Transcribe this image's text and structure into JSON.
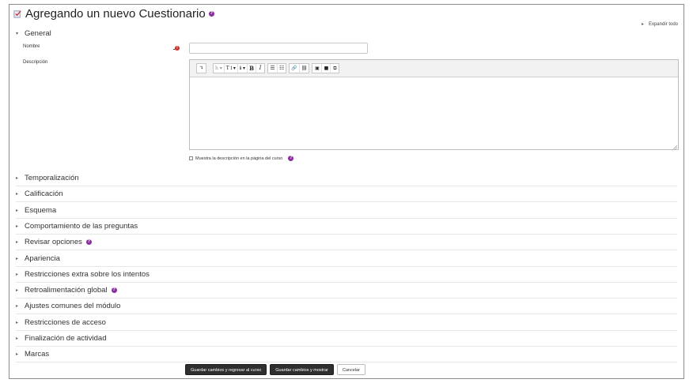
{
  "page": {
    "title": "Agregando un nuevo Cuestionario",
    "expand_all": "Expandir todo"
  },
  "general": {
    "header": "General",
    "name_label": "Nombre",
    "name_value": "",
    "description_label": "Descripción",
    "show_description_label": "Muestra la descripción en la página del curso",
    "toolbar": [
      "undo",
      "paragraph-styles",
      "font-size",
      "info",
      "bold",
      "italic",
      "bullet-list",
      "numbered-list",
      "link",
      "unlink",
      "image",
      "media",
      "manage-files"
    ]
  },
  "sections": [
    {
      "label": "Temporalización",
      "help": false
    },
    {
      "label": "Calificación",
      "help": false
    },
    {
      "label": "Esquema",
      "help": false
    },
    {
      "label": "Comportamiento de las preguntas",
      "help": false
    },
    {
      "label": "Revisar opciones",
      "help": true
    },
    {
      "label": "Apariencia",
      "help": false
    },
    {
      "label": "Restricciones extra sobre los intentos",
      "help": false
    },
    {
      "label": "Retroalimentación global",
      "help": true
    },
    {
      "label": "Ajustes comunes del módulo",
      "help": false
    },
    {
      "label": "Restricciones de acceso",
      "help": false
    },
    {
      "label": "Finalización de actividad",
      "help": false
    },
    {
      "label": "Marcas",
      "help": false
    }
  ],
  "buttons": {
    "save_return": "Guardar cambios y regresar al curso",
    "save_show": "Guardar cambios y mostrar",
    "cancel": "Cancelar"
  },
  "colors": {
    "help_icon": "#8b2d9f",
    "required_icon": "#c9302c",
    "primary_button": "#2f2f2f"
  }
}
